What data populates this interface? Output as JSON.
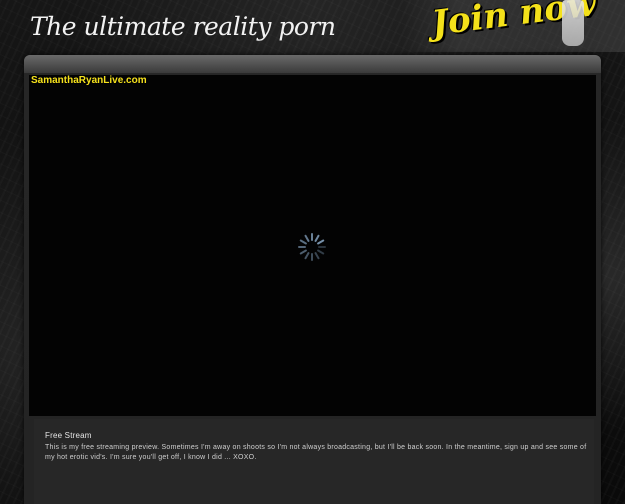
{
  "header": {
    "tagline": "The ultimate reality porn",
    "join_label": "Join now"
  },
  "player": {
    "site_watermark": "SamanthaRyanLive.com",
    "state": "loading",
    "spinner_icon": "loading-spinner-icon"
  },
  "info": {
    "title": "Free Stream",
    "body": "This is my free streaming preview.  Sometimes I'm away on shoots so I'm not always broadcasting, but I'll be back soon.  In the meantime, sign up and see some of my hot erotic vid's.  I'm sure you'll get off, I know I did ... XOXO."
  },
  "colors": {
    "accent_yellow": "#f4e11a",
    "background": "#0c0c0c",
    "panel": "#272727",
    "video_bg": "#030303"
  }
}
